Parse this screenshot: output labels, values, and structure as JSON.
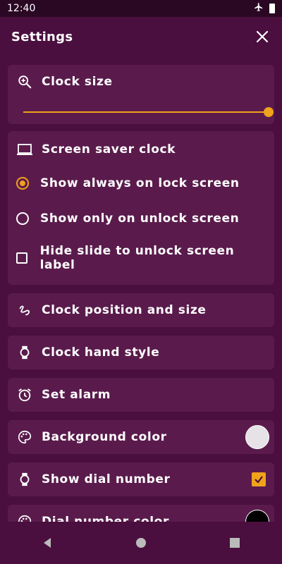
{
  "statusbar": {
    "time": "12:40"
  },
  "appbar": {
    "title": "Settings"
  },
  "clock_size": {
    "label": "Clock size",
    "slider_value_percent": 100
  },
  "screen_saver": {
    "label": "Screen saver clock",
    "options": [
      {
        "label": "Show always on lock screen",
        "type": "radio",
        "checked": true
      },
      {
        "label": "Show only on unlock screen",
        "type": "radio",
        "checked": false
      },
      {
        "label": "Hide slide to unlock screen label",
        "type": "checkbox",
        "checked": false
      }
    ]
  },
  "items": [
    {
      "label": "Clock position and size",
      "icon": "gesture-icon"
    },
    {
      "label": "Clock hand style",
      "icon": "watch-icon"
    },
    {
      "label": "Set alarm",
      "icon": "alarm-icon"
    },
    {
      "label": "Background color",
      "icon": "palette-icon",
      "color": "#e6e2e8"
    },
    {
      "label": "Show dial number",
      "icon": "watch-icon",
      "checked": true
    },
    {
      "label": "Dial number color",
      "icon": "palette-icon",
      "color": "#000000"
    }
  ],
  "colors": {
    "background": "#4a0f3e",
    "card": "#5a1b4c",
    "accent": "#f0a21a"
  }
}
